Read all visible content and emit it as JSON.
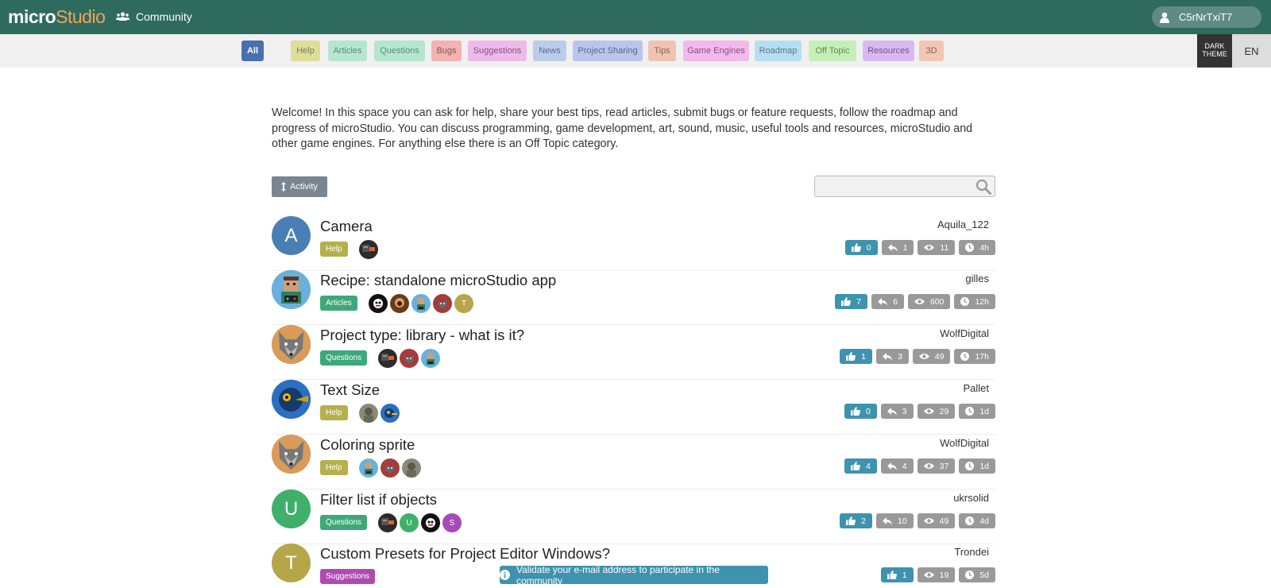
{
  "header": {
    "logo_micro": "micro",
    "logo_studio": "Studio",
    "community_label": "Community",
    "user_name": "C5rNrTxiT7"
  },
  "categories": [
    {
      "label": "All",
      "bg": "#4a6fb0",
      "fg": "#ffffff"
    },
    {
      "label": "Help",
      "bg": "#dede9a",
      "fg": "#7a7a55"
    },
    {
      "label": "Articles",
      "bg": "#b6e6cf",
      "fg": "#5a8a73"
    },
    {
      "label": "Questions",
      "bg": "#b6e6cf",
      "fg": "#5a8a73"
    },
    {
      "label": "Bugs",
      "bg": "#f3b3b3",
      "fg": "#8a5050"
    },
    {
      "label": "Suggestions",
      "bg": "#eebbe8",
      "fg": "#8a4c84"
    },
    {
      "label": "News",
      "bg": "#bbcde9",
      "fg": "#5a6e8e"
    },
    {
      "label": "Project Sharing",
      "bg": "#bbc5ec",
      "fg": "#5a6390"
    },
    {
      "label": "Tips",
      "bg": "#f0c4b0",
      "fg": "#8a6250"
    },
    {
      "label": "Game Engines",
      "bg": "#f2b9ec",
      "fg": "#8a4c84"
    },
    {
      "label": "Roadmap",
      "bg": "#b6def0",
      "fg": "#507a8e"
    },
    {
      "label": "Off Topic",
      "bg": "#c6efb8",
      "fg": "#5b8a4c"
    },
    {
      "label": "Resources",
      "bg": "#d9b9ef",
      "fg": "#70508a"
    },
    {
      "label": "3D",
      "bg": "#f2c6b3",
      "fg": "#8a6250"
    }
  ],
  "theme_toggle": {
    "line1": "DARK",
    "line2": "THEME"
  },
  "lang": "EN",
  "intro": "Welcome! In this space you can ask for help, share your best tips, read articles, submit bugs or feature requests, follow the roadmap and progress of microStudio. You can discuss programming, game development, art, sound, music, useful tools and resources, microStudio and other game engines. For anything else there is an Off Topic category.",
  "controls": {
    "sort_label": "Activity",
    "search_placeholder": ""
  },
  "posts": [
    {
      "title": "Camera",
      "author": "Aquila_122",
      "category": "Help",
      "cat_color": "#b5b04a",
      "avatar_letter": "A",
      "avatar_color": "#4a7fb5",
      "likes": "0",
      "replies": "1",
      "views": "11",
      "time": "4h",
      "participants": [
        {
          "kind": "dark",
          "letter": ""
        }
      ]
    },
    {
      "title": "Recipe: standalone microStudio app",
      "author": "gilles",
      "category": "Articles",
      "cat_color": "#3ea87a",
      "avatar_letter": "",
      "avatar_color": "#6ab0dc",
      "likes": "7",
      "replies": "6",
      "views": "600",
      "time": "12h",
      "participants": [
        {
          "kind": "black",
          "letter": ""
        },
        {
          "kind": "brown",
          "letter": ""
        },
        {
          "kind": "blue",
          "letter": ""
        },
        {
          "kind": "red",
          "letter": ""
        },
        {
          "kind": "olive",
          "letter": "T"
        }
      ]
    },
    {
      "title": "Project type: library - what is it?",
      "author": "WolfDigital",
      "category": "Questions",
      "cat_color": "#3ea87a",
      "avatar_letter": "",
      "avatar_color": "#d99a5a",
      "likes": "1",
      "replies": "3",
      "views": "49",
      "time": "17h",
      "participants": [
        {
          "kind": "dark",
          "letter": ""
        },
        {
          "kind": "red",
          "letter": ""
        },
        {
          "kind": "blue",
          "letter": ""
        }
      ]
    },
    {
      "title": "Text Size",
      "author": "Pallet",
      "category": "Help",
      "cat_color": "#b5b04a",
      "avatar_letter": "",
      "avatar_color": "#2a6fc0",
      "likes": "0",
      "replies": "3",
      "views": "29",
      "time": "1d",
      "participants": [
        {
          "kind": "gray",
          "letter": ""
        },
        {
          "kind": "navy",
          "letter": ""
        }
      ]
    },
    {
      "title": "Coloring sprite",
      "author": "WolfDigital",
      "category": "Help",
      "cat_color": "#b5b04a",
      "avatar_letter": "",
      "avatar_color": "#d99a5a",
      "likes": "4",
      "replies": "4",
      "views": "37",
      "time": "1d",
      "participants": [
        {
          "kind": "blue",
          "letter": ""
        },
        {
          "kind": "red",
          "letter": ""
        },
        {
          "kind": "gray",
          "letter": ""
        }
      ]
    },
    {
      "title": "Filter list if objects",
      "author": "ukrsolid",
      "category": "Questions",
      "cat_color": "#3ea87a",
      "avatar_letter": "U",
      "avatar_color": "#3fb06a",
      "likes": "2",
      "replies": "10",
      "views": "49",
      "time": "4d",
      "participants": [
        {
          "kind": "dark",
          "letter": ""
        },
        {
          "kind": "green",
          "letter": "U"
        },
        {
          "kind": "black",
          "letter": ""
        },
        {
          "kind": "purple",
          "letter": "S"
        }
      ]
    },
    {
      "title": "Custom Presets for Project Editor Windows?",
      "author": "Trondei",
      "category": "Suggestions",
      "cat_color": "#b04ab0",
      "avatar_letter": "T",
      "avatar_color": "#b5a64a",
      "likes": "1",
      "replies": "",
      "views": "19",
      "time": "5d",
      "participants": []
    }
  ],
  "banner": "Validate your e-mail address to participate in the community"
}
